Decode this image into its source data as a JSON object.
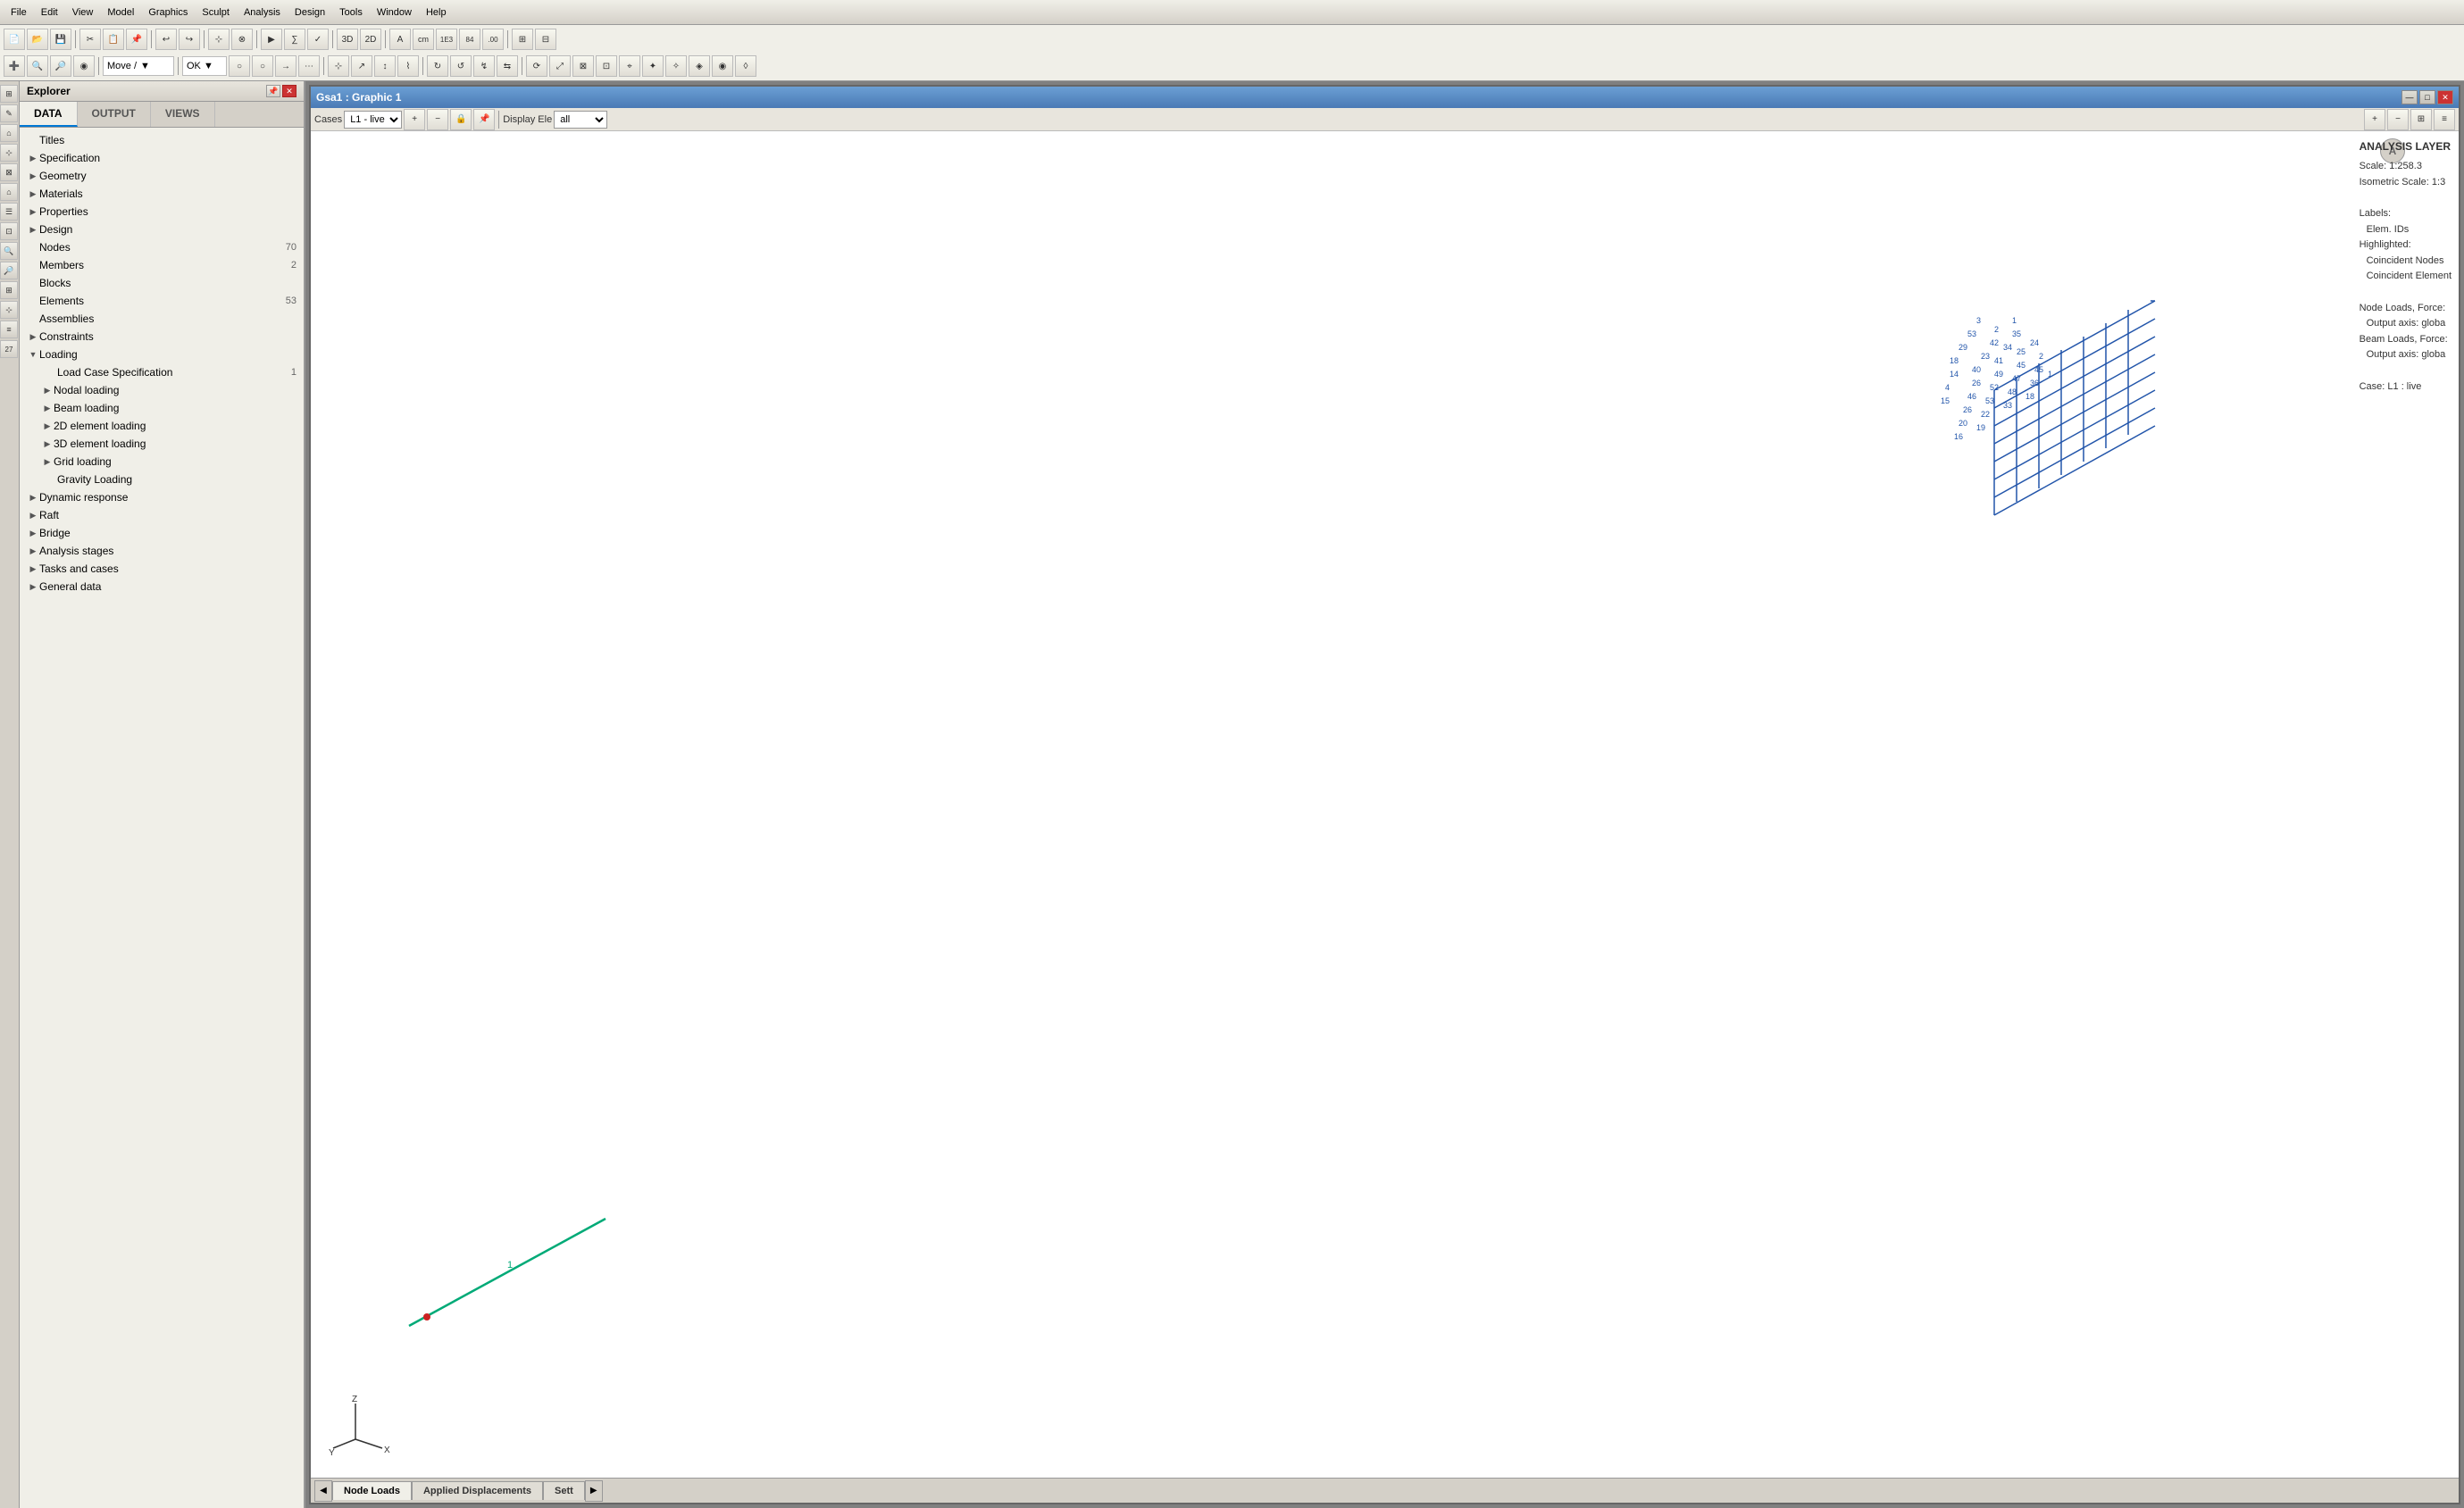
{
  "app": {
    "title": "GSA",
    "menu_items": [
      "File",
      "Edit",
      "View",
      "Model",
      "Graphics",
      "Sculpt",
      "Analysis",
      "Design",
      "Tools",
      "Window",
      "Help"
    ]
  },
  "explorer": {
    "title": "Explorer",
    "tabs": [
      "DATA",
      "OUTPUT",
      "VIEWS"
    ],
    "active_tab": "DATA"
  },
  "tree": {
    "items": [
      {
        "id": "titles",
        "label": "Titles",
        "level": 0,
        "type": "leaf",
        "count": ""
      },
      {
        "id": "specification",
        "label": "Specification",
        "level": 0,
        "type": "collapsed",
        "count": ""
      },
      {
        "id": "geometry",
        "label": "Geometry",
        "level": 0,
        "type": "collapsed",
        "count": ""
      },
      {
        "id": "materials",
        "label": "Materials",
        "level": 0,
        "type": "collapsed",
        "count": ""
      },
      {
        "id": "properties",
        "label": "Properties",
        "level": 0,
        "type": "collapsed",
        "count": ""
      },
      {
        "id": "design",
        "label": "Design",
        "level": 0,
        "type": "collapsed",
        "count": ""
      },
      {
        "id": "nodes",
        "label": "Nodes",
        "level": 0,
        "type": "leaf",
        "count": "70"
      },
      {
        "id": "members",
        "label": "Members",
        "level": 0,
        "type": "leaf",
        "count": "2"
      },
      {
        "id": "blocks",
        "label": "Blocks",
        "level": 0,
        "type": "leaf",
        "count": ""
      },
      {
        "id": "elements",
        "label": "Elements",
        "level": 0,
        "type": "leaf",
        "count": "53"
      },
      {
        "id": "assemblies",
        "label": "Assemblies",
        "level": 0,
        "type": "leaf",
        "count": ""
      },
      {
        "id": "constraints",
        "label": "Constraints",
        "level": 0,
        "type": "collapsed",
        "count": ""
      },
      {
        "id": "loading",
        "label": "Loading",
        "level": 0,
        "type": "expanded",
        "count": ""
      },
      {
        "id": "load-case-spec",
        "label": "Load Case Specification",
        "level": 1,
        "type": "leaf",
        "count": "1"
      },
      {
        "id": "nodal-loading",
        "label": "Nodal loading",
        "level": 1,
        "type": "collapsed",
        "count": ""
      },
      {
        "id": "beam-loading",
        "label": "Beam loading",
        "level": 1,
        "type": "collapsed",
        "count": ""
      },
      {
        "id": "2d-element-loading",
        "label": "2D element loading",
        "level": 1,
        "type": "collapsed",
        "count": ""
      },
      {
        "id": "3d-element-loading",
        "label": "3D element loading",
        "level": 1,
        "type": "collapsed",
        "count": ""
      },
      {
        "id": "grid-loading",
        "label": "Grid loading",
        "level": 1,
        "type": "collapsed",
        "count": ""
      },
      {
        "id": "gravity-loading",
        "label": "Gravity Loading",
        "level": 1,
        "type": "leaf",
        "count": ""
      },
      {
        "id": "dynamic-response",
        "label": "Dynamic response",
        "level": 0,
        "type": "collapsed",
        "count": ""
      },
      {
        "id": "raft",
        "label": "Raft",
        "level": 0,
        "type": "collapsed",
        "count": ""
      },
      {
        "id": "bridge",
        "label": "Bridge",
        "level": 0,
        "type": "collapsed",
        "count": ""
      },
      {
        "id": "analysis-stages",
        "label": "Analysis stages",
        "level": 0,
        "type": "collapsed",
        "count": ""
      },
      {
        "id": "tasks-and-cases",
        "label": "Tasks and cases",
        "level": 0,
        "type": "collapsed",
        "count": ""
      },
      {
        "id": "general-data",
        "label": "General data",
        "level": 0,
        "type": "collapsed",
        "count": ""
      }
    ]
  },
  "graphic_window": {
    "title": "Gsa1 : Graphic 1",
    "cases_label": "Cases",
    "cases_value": "L1 - live",
    "display_label": "Display Ele",
    "display_value": "all"
  },
  "analysis_layer": {
    "title": "ANALYSIS LAYER",
    "scale": "Scale: 1:258.3",
    "isometric_scale": "Isometric Scale: 1:3",
    "labels_title": "Labels:",
    "elem_ids": "Elem. IDs",
    "highlighted_title": "Highlighted:",
    "coincident_nodes": "Coincident Nodes",
    "coincident_element": "Coincident Element",
    "node_loads": "Node Loads, Force:",
    "output_axis_node": "Output axis: globa",
    "beam_loads": "Beam Loads, Force:",
    "output_axis_beam": "Output axis: globa",
    "case": "Case: L1 : live"
  },
  "bottom_tabs": {
    "tabs": [
      "Node Loads",
      "Applied Displacements",
      "Sett"
    ],
    "active": "Node Loads"
  },
  "avatar": {
    "initial": "A"
  }
}
